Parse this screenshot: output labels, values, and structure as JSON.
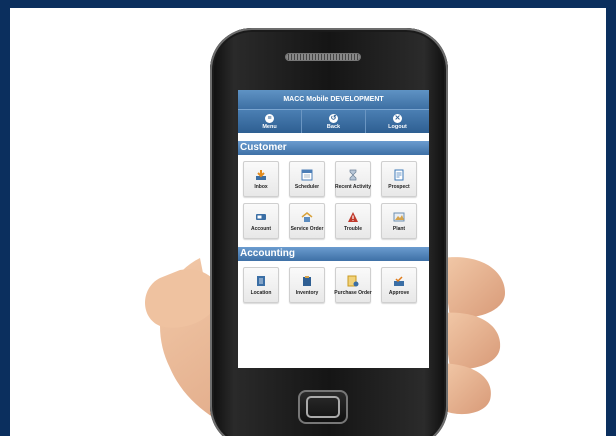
{
  "app": {
    "title": "MACC Mobile DEVELOPMENT"
  },
  "navbar": {
    "items": [
      {
        "label": "Menu",
        "icon": "menu-icon"
      },
      {
        "label": "Back",
        "icon": "back-icon"
      },
      {
        "label": "Logout",
        "icon": "logout-icon"
      }
    ]
  },
  "sections": [
    {
      "title": "Customer",
      "tiles": [
        {
          "label": "Inbox",
          "icon": "inbox-icon",
          "color": "#e38b1c"
        },
        {
          "label": "Scheduler",
          "icon": "scheduler-icon",
          "color": "#4d7fb7"
        },
        {
          "label": "Recent Activity",
          "icon": "recent-activity-icon",
          "color": "#7a8fa6"
        },
        {
          "label": "Prospect",
          "icon": "prospect-icon",
          "color": "#3d7ab8"
        },
        {
          "label": "Account",
          "icon": "account-icon",
          "color": "#3a6ea5"
        },
        {
          "label": "Service Order",
          "icon": "service-order-icon",
          "color": "#d8a13a"
        },
        {
          "label": "Trouble",
          "icon": "trouble-icon",
          "color": "#c0392b"
        },
        {
          "label": "Plant",
          "icon": "plant-icon",
          "color": "#6c8fb0"
        }
      ]
    },
    {
      "title": "Accounting",
      "tiles": [
        {
          "label": "Location",
          "icon": "location-icon",
          "color": "#3a6ea5"
        },
        {
          "label": "Inventory",
          "icon": "inventory-icon",
          "color": "#2f5f93"
        },
        {
          "label": "Purchase Order",
          "icon": "purchase-order-icon",
          "color": "#d9a521"
        },
        {
          "label": "Approve",
          "icon": "approve-icon",
          "color": "#e07b1a"
        }
      ]
    }
  ]
}
